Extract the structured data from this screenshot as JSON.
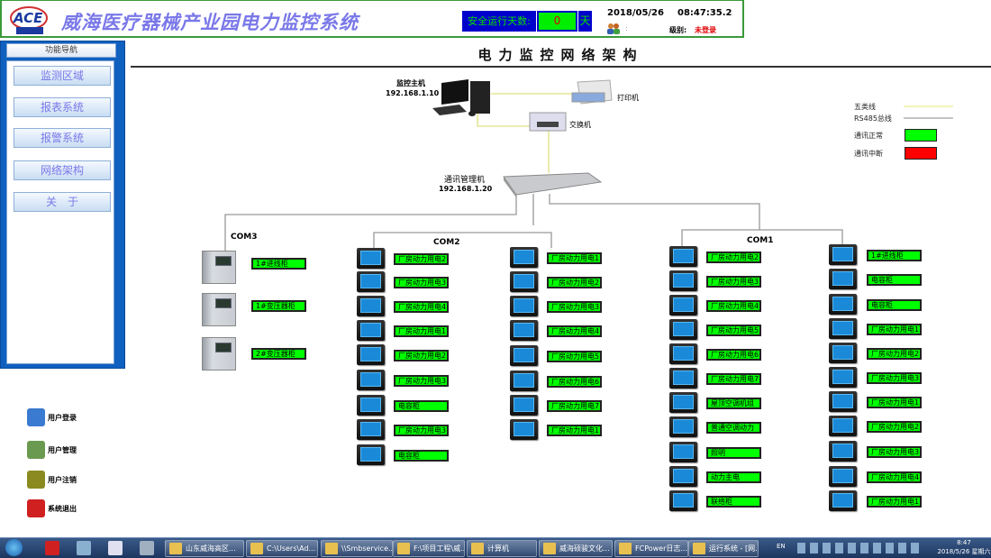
{
  "header": {
    "title": "威海医疗器械产业园电力监控系统",
    "logo_text": "ACE 优赛科技",
    "safe_days_label": "安全运行天数:",
    "safe_days_value": "0",
    "safe_days_unit": "天",
    "date": "2018/05/26",
    "time": "08:47:35.2",
    "user_colon": ":",
    "level_label": "级别:",
    "level_value": "未登录"
  },
  "sidebar": {
    "title": "功能导航",
    "items": [
      {
        "label": "监测区域"
      },
      {
        "label": "报表系统"
      },
      {
        "label": "报警系统"
      },
      {
        "label": "网络架构"
      },
      {
        "label": "关　于"
      }
    ]
  },
  "user_menu": [
    {
      "label": "用户登录",
      "icon": "user-login-icon",
      "color": "#3a7ad0"
    },
    {
      "label": "用户管理",
      "icon": "user-manage-icon",
      "color": "#6a9a50"
    },
    {
      "label": "用户注销",
      "icon": "key-icon",
      "color": "#8a8a20"
    },
    {
      "label": "系统退出",
      "icon": "power-icon",
      "color": "#d02020"
    }
  ],
  "page_title": "电力监控网络架构",
  "network": {
    "host_label": "监控主机",
    "host_ip": "192.168.1.10",
    "printer_label": "打印机",
    "switch_label": "交换机",
    "manager_label": "通讯管理机",
    "manager_ip": "192.168.1.20",
    "com3": {
      "label": "COM3",
      "devices": [
        "1#进线柜",
        "1#变压器柜",
        "2#变压器柜"
      ]
    },
    "com2": {
      "label": "COM2",
      "col1": [
        "厂房动力用电2",
        "厂房动力用电3",
        "厂房动力用电4",
        "厂房动力用电1",
        "厂房动力用电2",
        "厂房动力用电3",
        "电容柜",
        "厂房动力用电3",
        "电容柜"
      ],
      "col2": [
        "厂房动力用电1",
        "厂房动力用电2",
        "厂房动力用电3",
        "厂房动力用电4",
        "厂房动力用电5",
        "厂房动力用电6",
        "厂房动力用电7",
        "厂房动力用电1"
      ]
    },
    "com1": {
      "label": "COM1",
      "col1": [
        "厂房动力用电2",
        "厂房动力用电3",
        "厂房动力用电4",
        "厂房动力用电5",
        "厂房动力用电6",
        "厂房动力用电7",
        "屋顶空调机组",
        "普通空调动力",
        "照明",
        "动力主电",
        "联络柜"
      ],
      "col2": [
        "1#进线柜",
        "电容柜",
        "电容柜",
        "厂房动力用电1",
        "厂房动力用电2",
        "厂房动力用电3",
        "厂房动力用电1",
        "厂房动力用电2",
        "厂房动力用电3",
        "厂房动力用电4",
        "厂房动力用电1"
      ]
    }
  },
  "legend": {
    "cat5": "五类线",
    "rs485": "RS485总线",
    "normal": "通讯正常",
    "fault": "通讯中断"
  },
  "colors": {
    "normal": "#00ff00",
    "fault": "#ff0000",
    "cat5_line": "#e8e890",
    "rs485_line": "#999999",
    "accent": "#0000cc"
  },
  "taskbar": {
    "items": [
      "山东威海高区...",
      "C:\\Users\\Ad...",
      "\\\\Smbservice...",
      "F:\\项目工程\\威...",
      "计算机",
      "威海硕骏文化...",
      "FCPower日志...",
      "运行系统 - [网..."
    ],
    "lang": "EN",
    "clock_time": "8:47",
    "clock_date": "2018/5/26 星期六"
  }
}
